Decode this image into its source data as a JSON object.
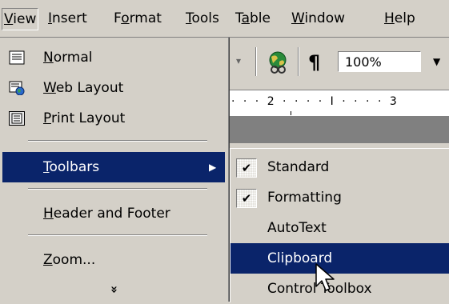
{
  "menubar": {
    "items": [
      {
        "pre": "",
        "key": "V",
        "post": "iew"
      },
      {
        "pre": "",
        "key": "I",
        "post": "nsert"
      },
      {
        "pre": "F",
        "key": "o",
        "post": "rmat"
      },
      {
        "pre": "",
        "key": "T",
        "post": "ools"
      },
      {
        "pre": "T",
        "key": "a",
        "post": "ble"
      },
      {
        "pre": "",
        "key": "W",
        "post": "indow"
      },
      {
        "pre": "",
        "key": "H",
        "post": "elp"
      }
    ]
  },
  "toolbar": {
    "zoom_value": "100%",
    "paragraph_mark": "¶"
  },
  "ruler": {
    "text": "· · · 2 · · · · I · · · · 3"
  },
  "view_menu": {
    "items": [
      {
        "key": "N",
        "post": "ormal",
        "icon": "normal-view-icon"
      },
      {
        "key": "W",
        "post": "eb Layout",
        "icon": "web-layout-icon"
      },
      {
        "key": "P",
        "post": "rint Layout",
        "icon": "print-layout-icon"
      },
      {
        "key": "T",
        "post": "oolbars",
        "arrow": "▶"
      },
      {
        "key": "H",
        "post": "eader and Footer"
      },
      {
        "key": "Z",
        "post": "oom..."
      }
    ],
    "more": "»"
  },
  "toolbars_submenu": {
    "items": [
      {
        "label": "Standard",
        "checked": true
      },
      {
        "label": "Formatting",
        "checked": true
      },
      {
        "label": "AutoText",
        "checked": false
      },
      {
        "label": "Clipboard",
        "checked": false,
        "highlighted": true
      },
      {
        "label": "Control Toolbox",
        "checked": false
      }
    ],
    "check_glyph": "✔"
  },
  "colors": {
    "menu_bg": "#d4d0c8",
    "highlight": "#0a246a",
    "highlight_text": "#ffffff"
  }
}
